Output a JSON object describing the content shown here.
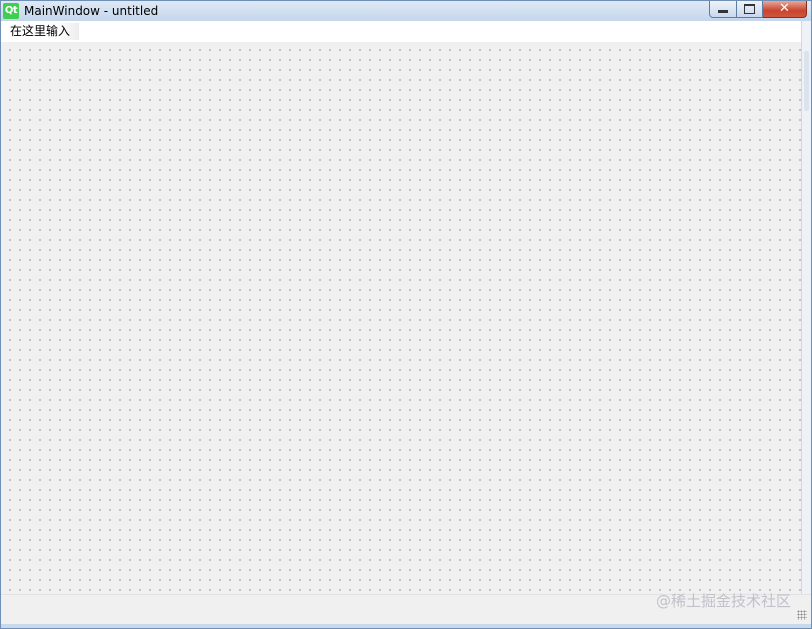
{
  "window": {
    "app_icon_text": "Qt",
    "title": "MainWindow - untitled"
  },
  "menubar": {
    "placeholder_item": "在这里输入"
  },
  "watermark": {
    "text": "@稀土掘金技术社区"
  },
  "colors": {
    "titlebar": "#c4d6ec",
    "canvas": "#f0f0f0",
    "grid_dot": "#909090",
    "close_button": "#c7452e",
    "qt_green": "#41cd52"
  }
}
